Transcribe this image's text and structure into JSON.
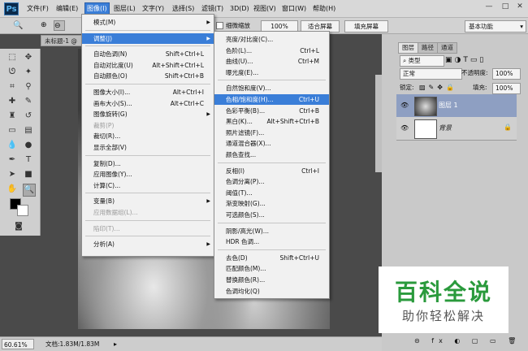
{
  "app": {
    "logo": "Ps"
  },
  "menubar": {
    "items": [
      "文件(F)",
      "编辑(E)",
      "图像(I)",
      "图层(L)",
      "文字(Y)",
      "选择(S)",
      "滤镜(T)",
      "3D(D)",
      "视图(V)",
      "窗口(W)",
      "帮助(H)"
    ],
    "active_index": 2,
    "window_controls": [
      "—",
      "□",
      "✕"
    ]
  },
  "optbar": {
    "zoom_checkbox_label": "细微缩放",
    "zoom_value": "100%",
    "fit_screen": "适合屏幕",
    "fill_screen": "填充屏幕",
    "workspace": "基本功能"
  },
  "document": {
    "tab": "未标题-1 @"
  },
  "statusbar": {
    "zoom": "60.61%",
    "doc_info": "文档:1.83M/1.83M"
  },
  "image_menu": [
    {
      "label": "模式(M)",
      "arrow": true
    },
    {
      "sep": true
    },
    {
      "label": "调整(J)",
      "arrow": true,
      "highlight": true
    },
    {
      "sep": true
    },
    {
      "label": "自动色调(N)",
      "shortcut": "Shift+Ctrl+L"
    },
    {
      "label": "自动对比度(U)",
      "shortcut": "Alt+Shift+Ctrl+L"
    },
    {
      "label": "自动颜色(O)",
      "shortcut": "Shift+Ctrl+B"
    },
    {
      "sep": true
    },
    {
      "label": "图像大小(I)...",
      "shortcut": "Alt+Ctrl+I"
    },
    {
      "label": "画布大小(S)...",
      "shortcut": "Alt+Ctrl+C"
    },
    {
      "label": "图像旋转(G)",
      "arrow": true
    },
    {
      "label": "裁剪(P)",
      "disabled": true
    },
    {
      "label": "裁切(R)..."
    },
    {
      "label": "显示全部(V)"
    },
    {
      "sep": true
    },
    {
      "label": "复制(D)..."
    },
    {
      "label": "应用图像(Y)..."
    },
    {
      "label": "计算(C)..."
    },
    {
      "sep": true
    },
    {
      "label": "变量(B)",
      "arrow": true
    },
    {
      "label": "应用数据组(L)...",
      "disabled": true
    },
    {
      "sep": true
    },
    {
      "label": "陷印(T)...",
      "disabled": true
    },
    {
      "sep": true
    },
    {
      "label": "分析(A)",
      "arrow": true
    }
  ],
  "adjust_menu": [
    {
      "label": "亮度/对比度(C)..."
    },
    {
      "label": "色阶(L)...",
      "shortcut": "Ctrl+L"
    },
    {
      "label": "曲线(U)...",
      "shortcut": "Ctrl+M"
    },
    {
      "label": "曝光度(E)..."
    },
    {
      "sep": true
    },
    {
      "label": "自然饱和度(V)..."
    },
    {
      "label": "色相/饱和度(H)...",
      "shortcut": "Ctrl+U",
      "highlight": true
    },
    {
      "label": "色彩平衡(B)...",
      "shortcut": "Ctrl+B"
    },
    {
      "label": "黑白(K)...",
      "shortcut": "Alt+Shift+Ctrl+B"
    },
    {
      "label": "照片滤镜(F)..."
    },
    {
      "label": "通道混合器(X)..."
    },
    {
      "label": "颜色查找..."
    },
    {
      "sep": true
    },
    {
      "label": "反相(I)",
      "shortcut": "Ctrl+I"
    },
    {
      "label": "色调分离(P)..."
    },
    {
      "label": "阈值(T)..."
    },
    {
      "label": "渐变映射(G)..."
    },
    {
      "label": "可选颜色(S)..."
    },
    {
      "sep": true
    },
    {
      "label": "阴影/高光(W)..."
    },
    {
      "label": "HDR 色调..."
    },
    {
      "sep": true
    },
    {
      "label": "去色(D)",
      "shortcut": "Shift+Ctrl+U"
    },
    {
      "label": "匹配颜色(M)..."
    },
    {
      "label": "替换颜色(R)..."
    },
    {
      "label": "色调均化(Q)"
    }
  ],
  "layers_panel": {
    "tabs": [
      "图层",
      "路径",
      "通道"
    ],
    "filter": "类型",
    "blend_mode": "正常",
    "opacity_label": "不透明度:",
    "opacity": "100%",
    "lock_label": "锁定:",
    "fill_label": "填充:",
    "fill": "100%",
    "layers": [
      {
        "name": "图层 1",
        "selected": true
      },
      {
        "name": "背景",
        "locked": true
      }
    ]
  },
  "watermark": {
    "title": "百科全说",
    "subtitle": "助你轻松解决"
  },
  "colors": {
    "menu_highlight": "#3a7ed8",
    "watermark_green": "#2a9a3c"
  }
}
